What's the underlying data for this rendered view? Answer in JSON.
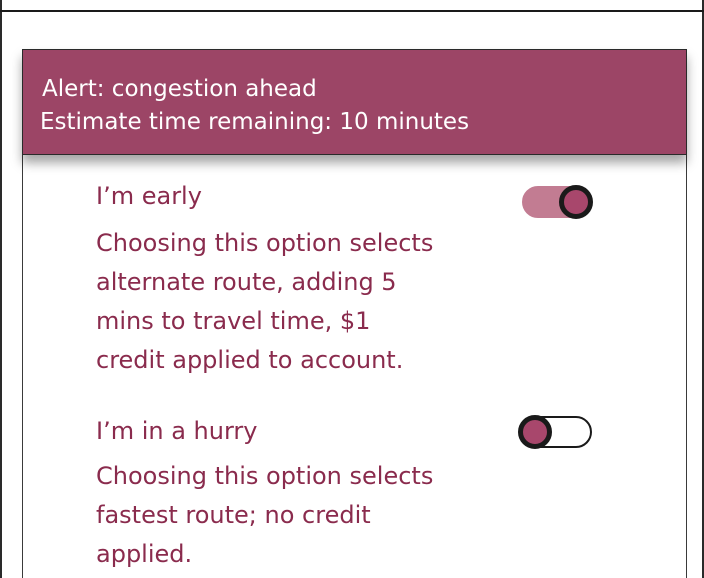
{
  "alert": {
    "line1": "Alert: congestion ahead",
    "line2": "Estimate time remaining: 10 minutes"
  },
  "options": [
    {
      "title": "I’m early",
      "description_lines": [
        "Choosing this option selects",
        "alternate route, adding 5",
        "mins to travel time, $1",
        "credit applied to account."
      ],
      "enabled": true
    },
    {
      "title": "I’m in a hurry",
      "description_lines": [
        "Choosing this option selects",
        "fastest route; no credit",
        "applied."
      ],
      "enabled": false
    }
  ],
  "colors": {
    "accent": "#9c4566",
    "text": "#8a2b4d",
    "toggle_on_track": "#c27c92",
    "knob": "#a8476c"
  }
}
